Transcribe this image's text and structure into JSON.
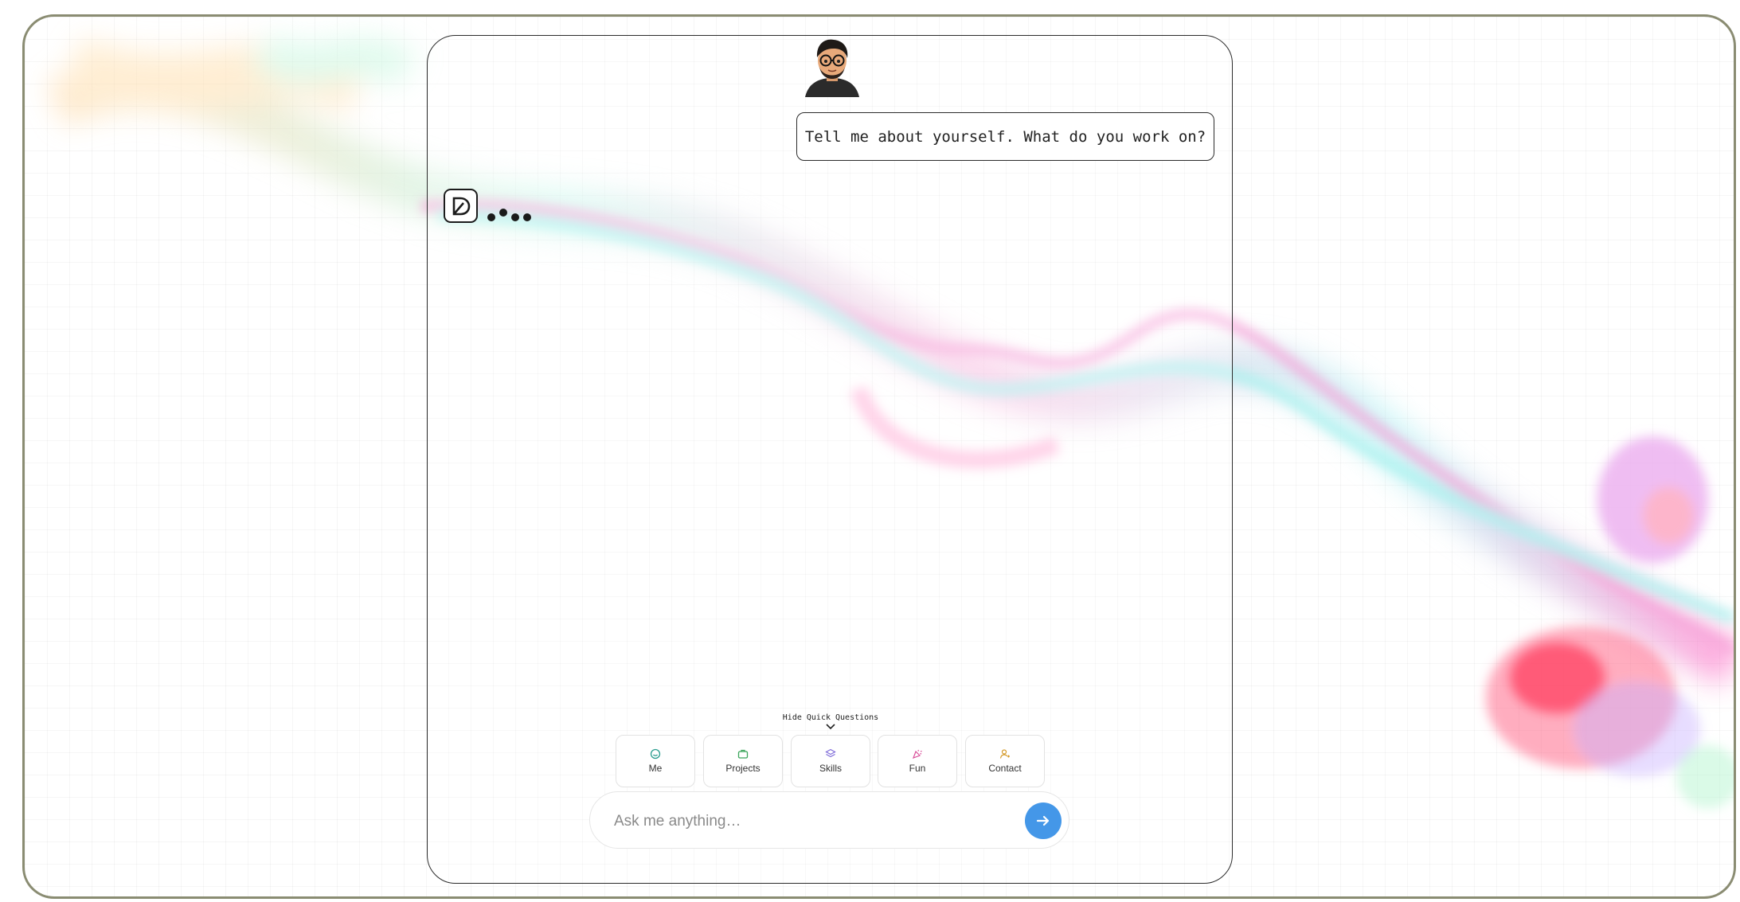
{
  "chat": {
    "user_message": "Tell me about yourself. What do you work on?",
    "bot_logo": "d-logo-icon",
    "typing_indicator": "typing-dots"
  },
  "quick_questions": {
    "toggle_label": "Hide Quick Questions",
    "items": [
      {
        "label": "Me",
        "icon": "smile-face-icon",
        "color": "#2a9d8f"
      },
      {
        "label": "Projects",
        "icon": "briefcase-icon",
        "color": "#3aa55a"
      },
      {
        "label": "Skills",
        "icon": "layers-icon",
        "color": "#7e6ad8"
      },
      {
        "label": "Fun",
        "icon": "party-popper-icon",
        "color": "#d94f9a"
      },
      {
        "label": "Contact",
        "icon": "user-contact-icon",
        "color": "#d49a2a"
      }
    ]
  },
  "input": {
    "placeholder": "Ask me anything…"
  },
  "colors": {
    "frame_border": "#8a8c72",
    "send_button": "#4497e8"
  }
}
